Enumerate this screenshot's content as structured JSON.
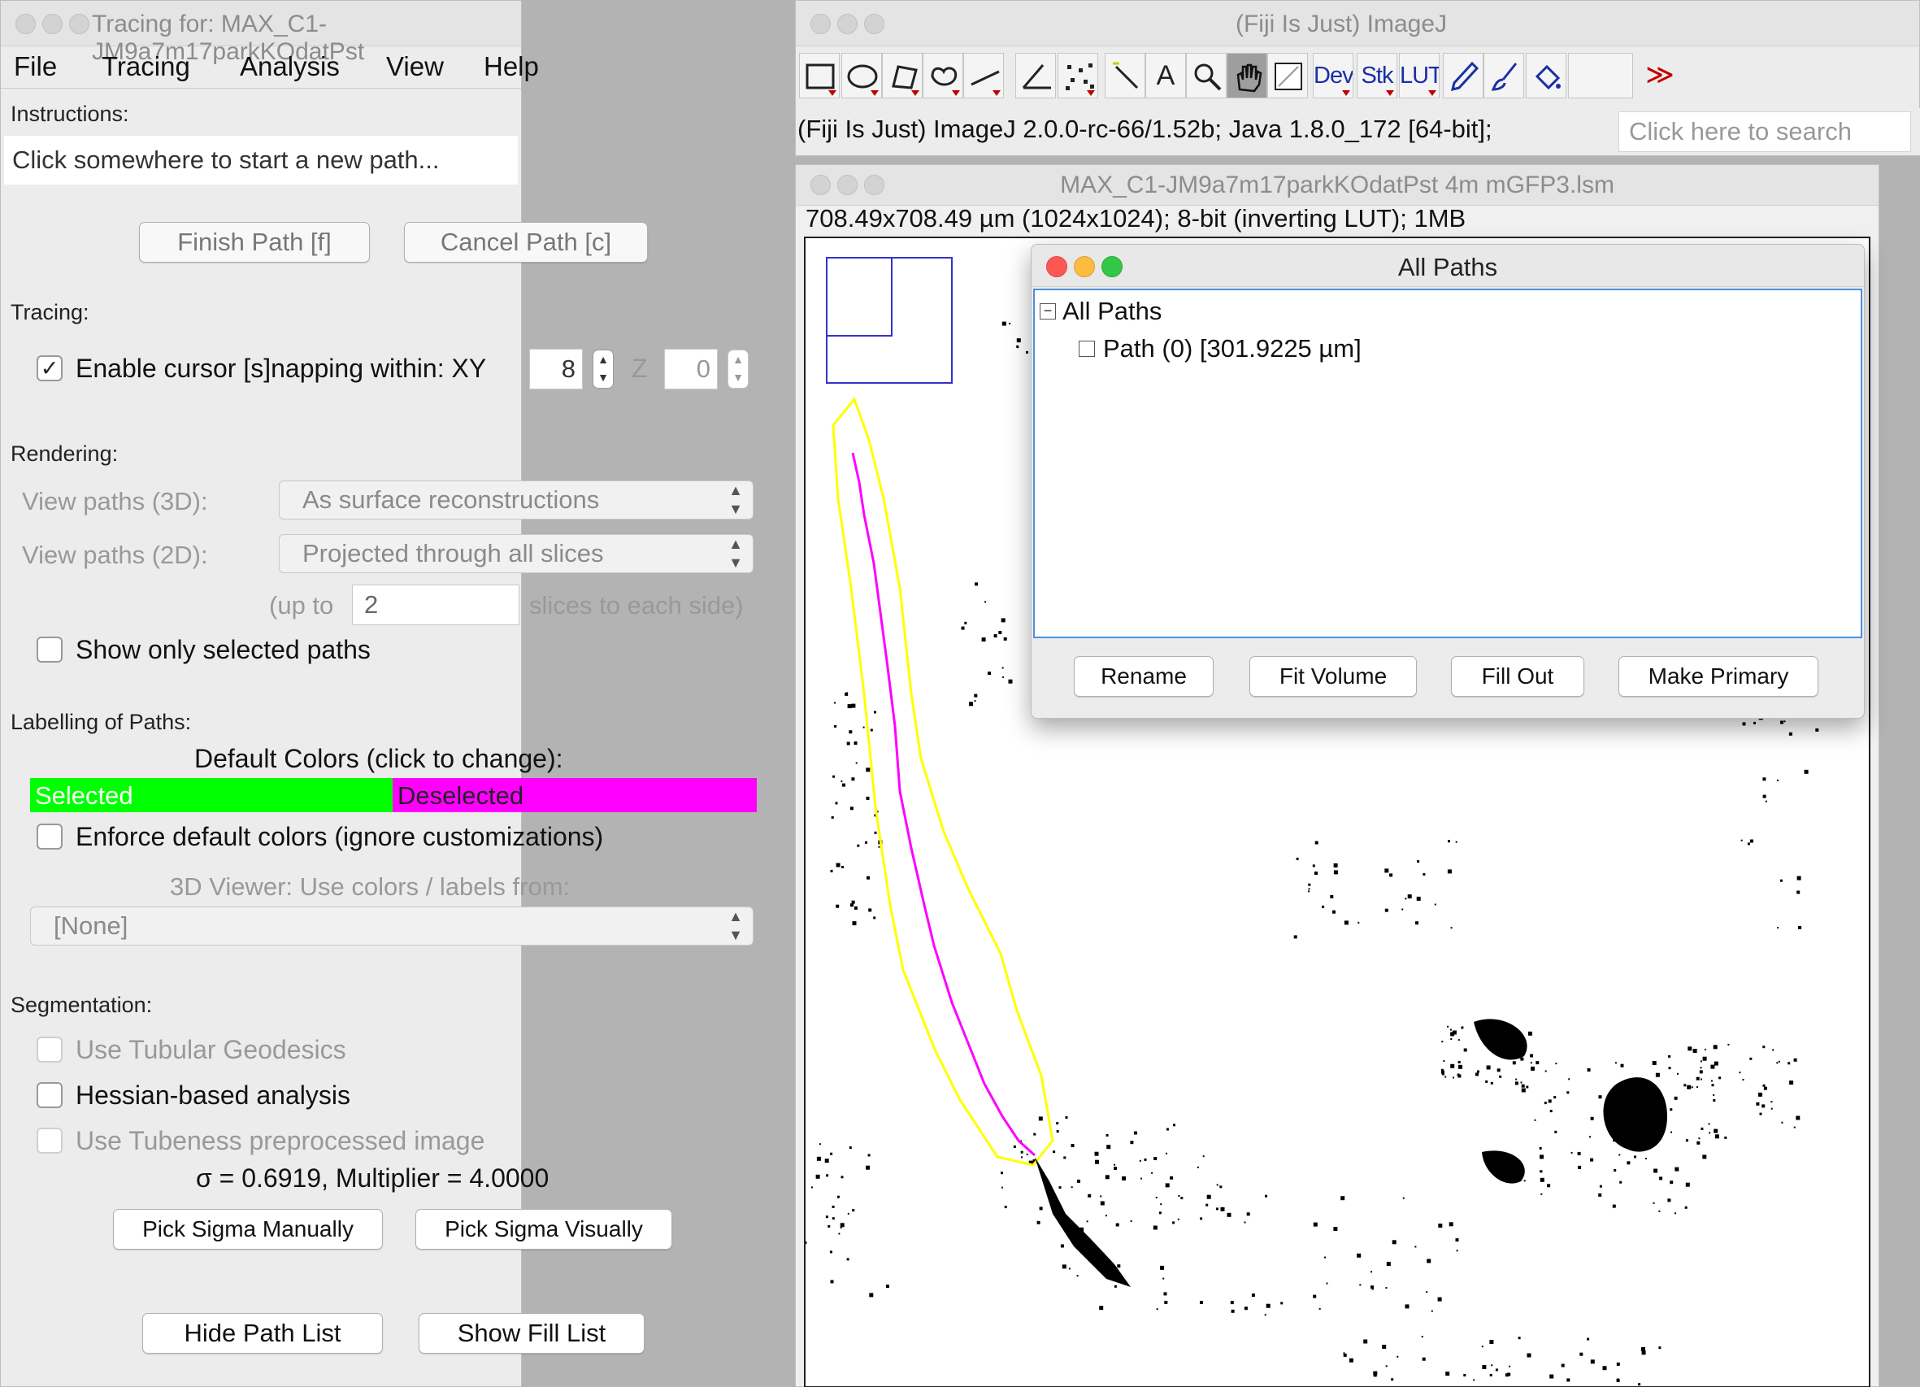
{
  "tracing_window": {
    "title": "Tracing for: MAX_C1-JM9a7m17parkKOdatPst",
    "menu": [
      "File",
      "Tracing",
      "Analysis",
      "View",
      "Help"
    ],
    "instructions_label": "Instructions:",
    "instructions_text": "Click somewhere to start a new path...",
    "finish_path": "Finish Path [f]",
    "cancel_path": "Cancel Path [c]",
    "tracing_label": "Tracing:",
    "snapping_label": "Enable cursor [s]napping within: XY",
    "snapping_checked": "✓",
    "xy_value": "8",
    "z_label": "Z",
    "z_value": "0",
    "rendering_label": "Rendering:",
    "view3d_label": "View paths (3D):",
    "view3d_value": "As surface reconstructions",
    "view2d_label": "View paths (2D):",
    "view2d_value": "Projected through all slices",
    "upto_label": "(up to",
    "upto_value": "2",
    "slices_label": "slices to each side)",
    "show_selected": "Show only selected paths",
    "labelling_label": "Labelling of Paths:",
    "default_colors": "Default Colors (click to change):",
    "selected": "Selected",
    "deselected": "Deselected",
    "selected_color": "#00ff00",
    "deselected_color": "#ff00ff",
    "enforce": "Enforce default colors (ignore customizations)",
    "viewer_label": "3D Viewer: Use colors / labels from:",
    "viewer_value": "[None]",
    "segmentation_label": "Segmentation:",
    "tubular": "Use Tubular Geodesics",
    "hessian": "Hessian-based analysis",
    "tubeness": "Use Tubeness preprocessed image",
    "sigma_text": "σ = 0.6919, Multiplier = 4.0000",
    "pick_manual": "Pick Sigma Manually",
    "pick_visual": "Pick Sigma Visually",
    "hide_path_list": "Hide Path List",
    "show_fill_list": "Show Fill List"
  },
  "imagej_window": {
    "title": "(Fiji Is Just) ImageJ",
    "tools": [
      "rectangle-tool",
      "oval-tool",
      "polygon-tool",
      "freehand-tool",
      "line-tool",
      "angle-tool",
      "multipoint-tool",
      "wand-tool",
      "text-tool",
      "magnifier-tool",
      "hand-tool",
      "color-picker-tool",
      "Dev",
      "Stk",
      "LUT",
      "pencil-tool",
      "brush-tool",
      "flood-fill-tool",
      "empty-tool",
      "more-tools"
    ],
    "tool_labels": {
      "text": "A",
      "dev": "Dev",
      "stk": "Stk",
      "lut": "LUT",
      "more": "≫"
    },
    "status": "(Fiji Is Just) ImageJ 2.0.0-rc-66/1.52b; Java 1.8.0_172 [64-bit];",
    "search_placeholder": "Click here to search"
  },
  "image_window": {
    "title": "MAX_C1-JM9a7m17parkKOdatPst 4m mGFP3.lsm",
    "info": "708.49x708.49 µm (1024x1024); 8-bit (inverting LUT); 1MB",
    "roi_color": "#ffff00",
    "path_color": "#ff00ff",
    "navigator_color": "#3333cc"
  },
  "all_paths_window": {
    "title": "All Paths",
    "tree_root": "All Paths",
    "tree_toggle": "−",
    "path_item": "Path (0) [301.9225 µm]",
    "rename": "Rename",
    "fit_volume": "Fit Volume",
    "fill_out": "Fill Out",
    "make_primary": "Make Primary"
  }
}
